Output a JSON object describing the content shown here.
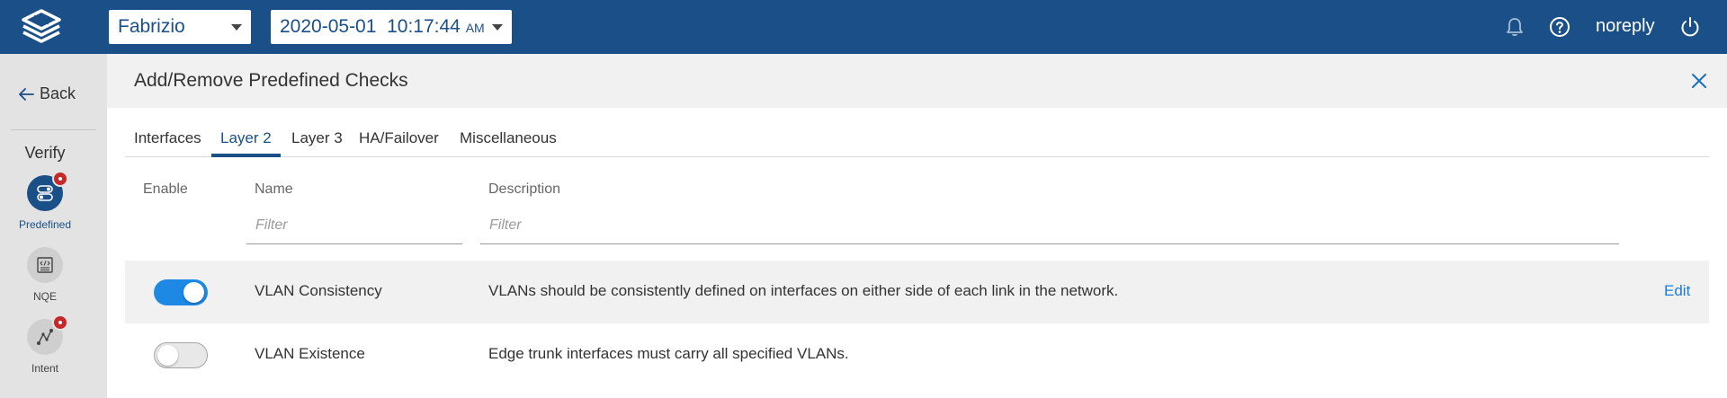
{
  "topbar": {
    "user_select": "Fabrizio",
    "time_select": {
      "date": "2020-05-01",
      "time": "10:17:44",
      "ampm": "AM"
    },
    "username": "noreply",
    "icons": [
      "logo-icon",
      "bell-icon",
      "help-icon",
      "power-icon"
    ]
  },
  "leftnav": {
    "back_label": "Back",
    "section_title": "Verify",
    "items": [
      {
        "label": "Predefined",
        "icon": "toggles-icon",
        "active": true,
        "badge": true
      },
      {
        "label": "NQE",
        "icon": "code-icon",
        "active": false,
        "badge": false
      },
      {
        "label": "Intent",
        "icon": "path-icon",
        "active": false,
        "badge": true
      }
    ]
  },
  "panel": {
    "title": "Add/Remove Predefined Checks",
    "tabs": [
      "Interfaces",
      "Layer 2",
      "Layer 3",
      "HA/Failover",
      "Miscellaneous"
    ],
    "active_tab": "Layer 2",
    "columns": {
      "enable": "Enable",
      "name": "Name",
      "description": "Description"
    },
    "filters": {
      "name_placeholder": "Filter",
      "description_placeholder": "Filter"
    },
    "rows": [
      {
        "enabled": true,
        "name": "VLAN Consistency",
        "description": "VLANs should be consistently defined on interfaces on either side of each link in the network.",
        "action": "Edit"
      },
      {
        "enabled": false,
        "name": "VLAN Existence",
        "description": "Edge trunk interfaces must carry all specified VLANs.",
        "action": ""
      }
    ]
  },
  "colors": {
    "brand": "#1b4f87",
    "toggle_on": "#1e88e5",
    "badge": "#c62828",
    "link": "#1e7bd6"
  }
}
